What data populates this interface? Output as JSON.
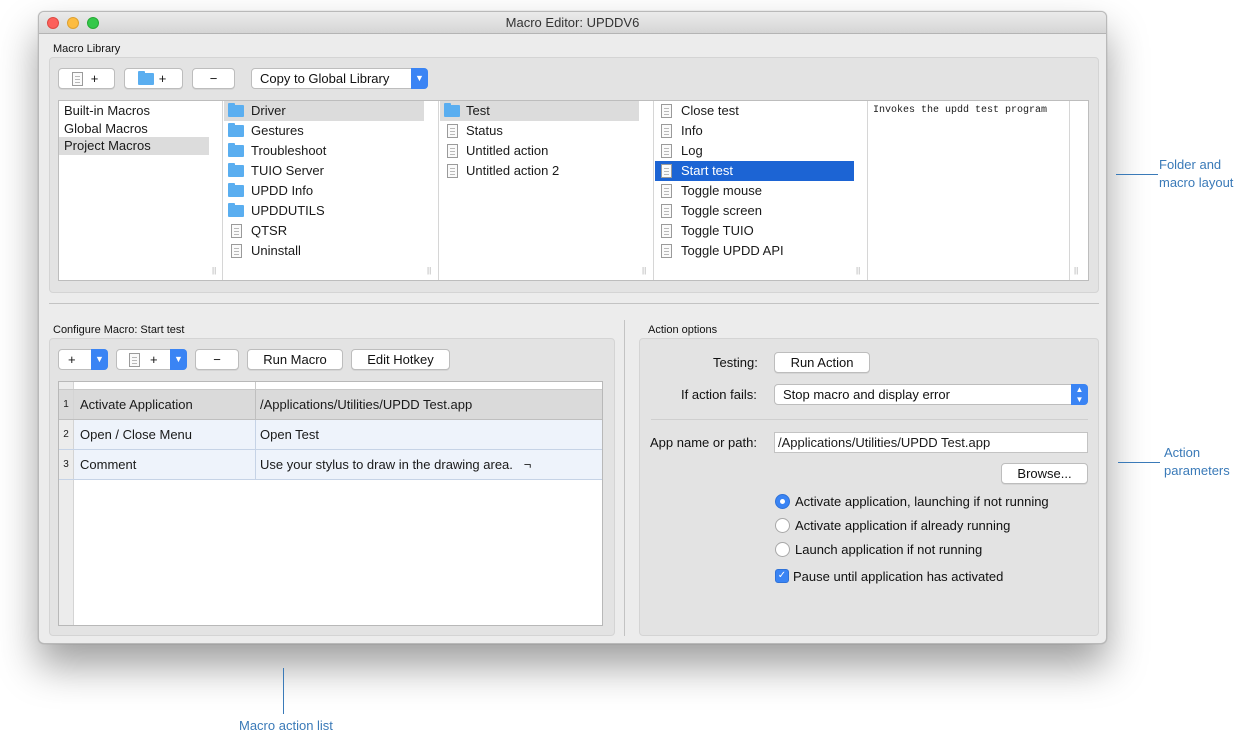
{
  "window": {
    "title": "Macro Editor: UPDDV6"
  },
  "library": {
    "label": "Macro Library",
    "toolbar": {
      "add_macro_label": "+",
      "add_folder_label": "+",
      "remove_label": "−",
      "copy_popup_value": "Copy to Global Library"
    },
    "scopes": [
      "Built-in Macros",
      "Global Macros",
      "Project Macros"
    ],
    "folders": [
      {
        "label": "Driver",
        "kind": "folder"
      },
      {
        "label": "Gestures",
        "kind": "folder"
      },
      {
        "label": "Troubleshoot",
        "kind": "folder"
      },
      {
        "label": "TUIO Server",
        "kind": "folder"
      },
      {
        "label": "UPDD Info",
        "kind": "folder"
      },
      {
        "label": "UPDDUTILS",
        "kind": "folder"
      },
      {
        "label": "QTSR",
        "kind": "doc"
      },
      {
        "label": "Uninstall",
        "kind": "doc"
      }
    ],
    "subitems": [
      {
        "label": "Test",
        "kind": "folder"
      },
      {
        "label": "Status",
        "kind": "doc"
      },
      {
        "label": "Untitled action",
        "kind": "doc"
      },
      {
        "label": "Untitled action 2",
        "kind": "doc"
      }
    ],
    "macros": [
      {
        "label": "Close test"
      },
      {
        "label": "Info"
      },
      {
        "label": "Log"
      },
      {
        "label": "Start test"
      },
      {
        "label": "Toggle mouse"
      },
      {
        "label": "Toggle screen"
      },
      {
        "label": "Toggle TUIO"
      },
      {
        "label": "Toggle UPDD API"
      }
    ],
    "description": "Invokes the updd test program"
  },
  "configure": {
    "label": "Configure Macro: Start test",
    "toolbar": {
      "add_label": "+",
      "add_doc_label": "+",
      "remove_label": "−",
      "run_macro_label": "Run Macro",
      "edit_hotkey_label": "Edit Hotkey"
    },
    "rows": [
      {
        "num": "1",
        "action": "Activate Application",
        "param": "/Applications/Utilities/UPDD Test.app"
      },
      {
        "num": "2",
        "action": "Open / Close Menu",
        "param": "Open Test"
      },
      {
        "num": "3",
        "action": "Comment",
        "param": "Use your stylus to draw in the drawing area.   ¬"
      }
    ]
  },
  "action_options": {
    "label": "Action options",
    "testing_label": "Testing:",
    "run_action_label": "Run Action",
    "if_fails_label": "If action fails:",
    "if_fails_value": "Stop macro and display error",
    "app_path_label": "App name or path:",
    "app_path_value": "/Applications/Utilities/UPDD Test.app",
    "browse_label": "Browse...",
    "radios": [
      {
        "label": "Activate application, launching if not running",
        "checked": true
      },
      {
        "label": "Activate application if already running",
        "checked": false
      },
      {
        "label": "Launch application if not running",
        "checked": false
      }
    ],
    "checkbox_label": "Pause until application has activated"
  },
  "annotations": {
    "folder_layout": "Folder and\nmacro layout",
    "action_parameters": "Action\nparameters",
    "macro_action_list": "Macro action list"
  },
  "colors": {
    "accent": "#3a84f4",
    "selection": "#1c64d4",
    "annotation": "#3a7ab8"
  }
}
